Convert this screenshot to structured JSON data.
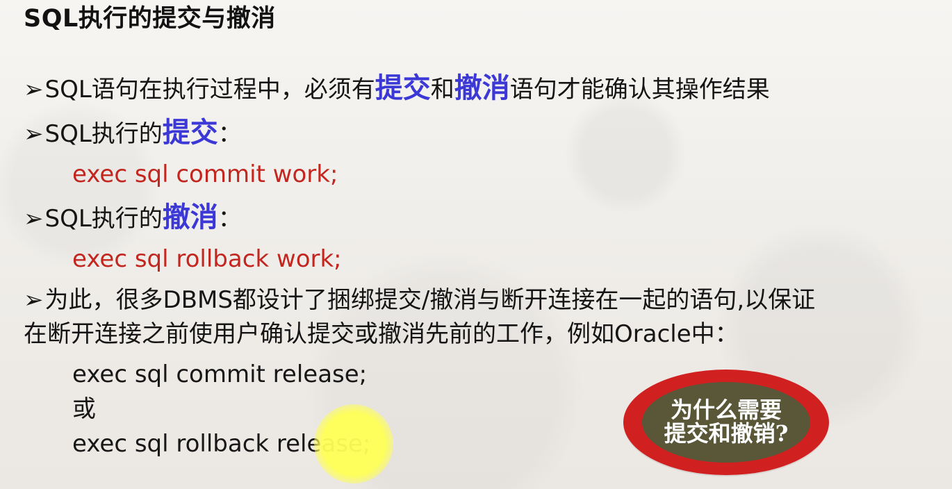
{
  "title": "SQL执行的提交与撤消",
  "bullets": {
    "symbol": "➢",
    "line1_prefix": "SQL语句在执行过程中，必须有",
    "line1_highlight1": "提交",
    "line1_middle": "和",
    "line1_highlight2": "撤消",
    "line1_suffix": "语句才能确认其操作结果",
    "line2_prefix": "SQL执行的",
    "line2_highlight": "提交",
    "line2_suffix": "：",
    "line3_prefix": "SQL执行的",
    "line3_highlight": "撤消",
    "line3_suffix": "：",
    "line4_prefix": "为此，很多DBMS都设计了捆绑提交/撤消与断开连接在一起的语句,以保证",
    "line4_suffix": "在断开连接之前使用户确认提交或撤消先前的工作，例如Oracle中："
  },
  "code": {
    "commit_work": "exec  sql  commit  work;",
    "rollback_work": "exec  sql  rollback  work;",
    "commit_release": "exec  sql  commit  release;",
    "or": "或",
    "rollback_release": "exec  sql  rollback  release;"
  },
  "badge": {
    "line1": "为什么需要",
    "line2": "提交和撤销?"
  },
  "colors": {
    "highlight": "#3b38d6",
    "code_red": "#c2261f",
    "badge_red": "#d12020",
    "badge_olive": "#595737",
    "cursor_yellow": "#ffff56"
  }
}
